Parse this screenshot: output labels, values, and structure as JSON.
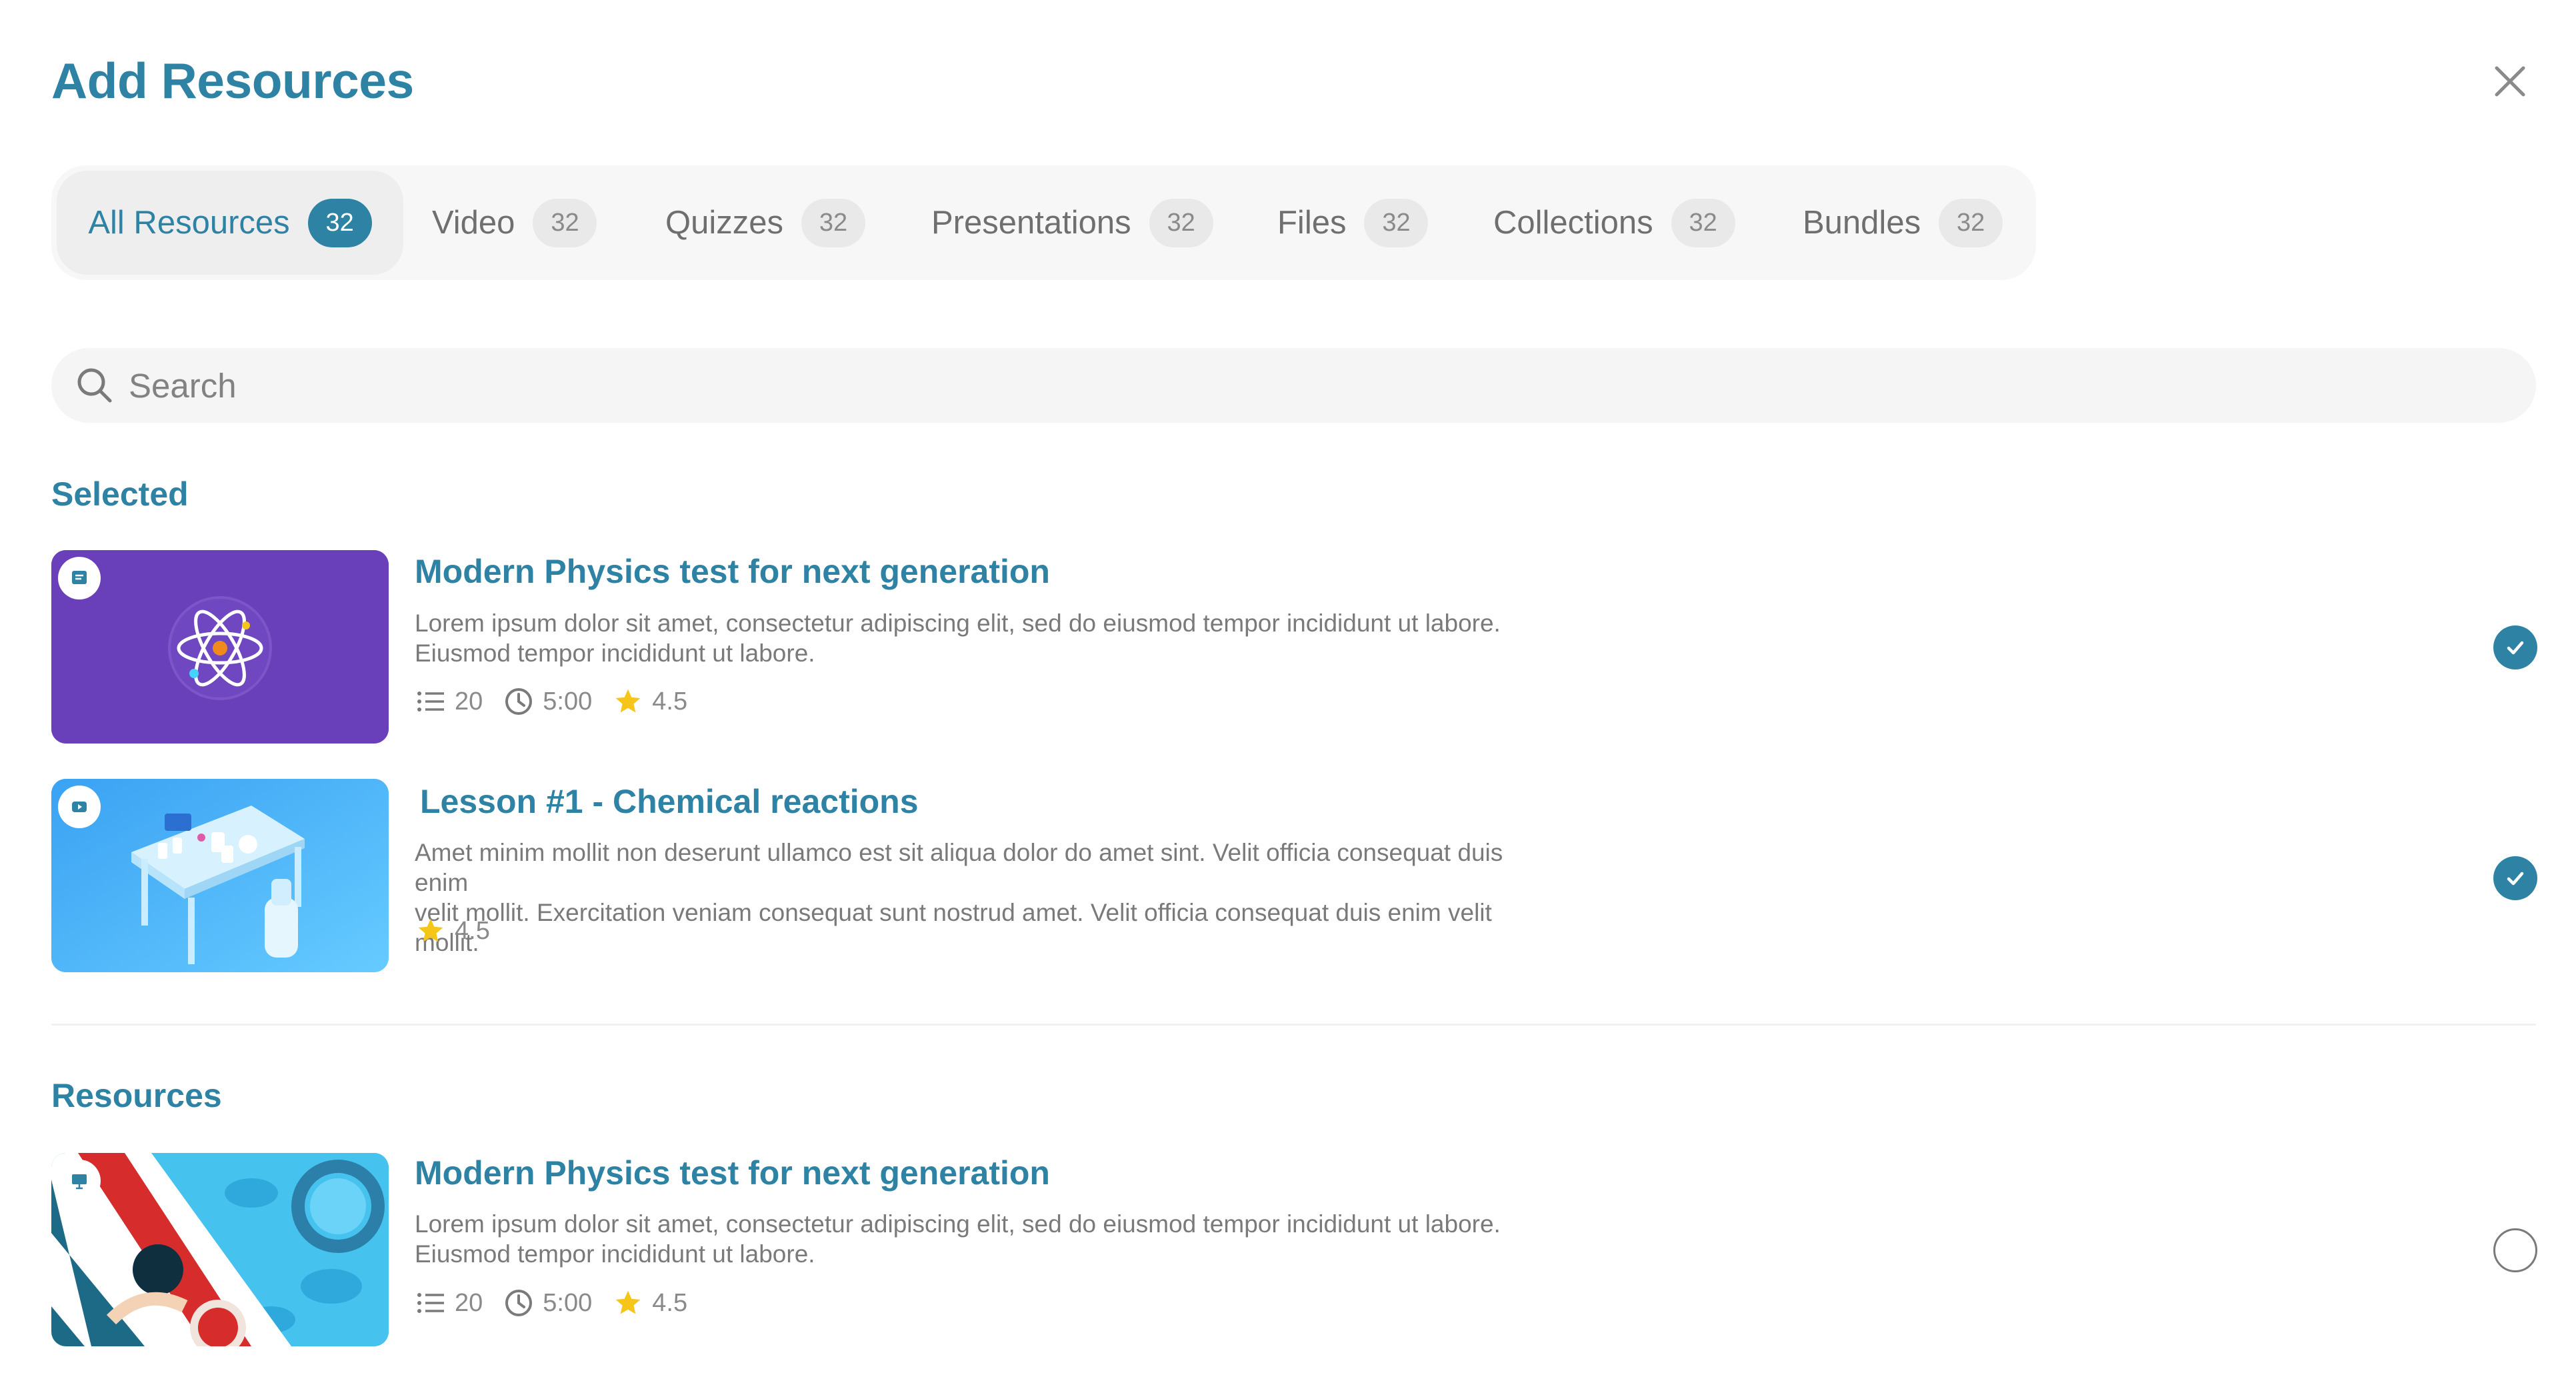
{
  "page": {
    "title": "Add Resources"
  },
  "tabs": [
    {
      "label": "All Resources",
      "count": "32",
      "active": true
    },
    {
      "label": "Video",
      "count": "32"
    },
    {
      "label": "Quizzes",
      "count": "32"
    },
    {
      "label": "Presentations",
      "count": "32"
    },
    {
      "label": "Files",
      "count": "32"
    },
    {
      "label": "Collections",
      "count": "32"
    },
    {
      "label": "Bundles",
      "count": "32"
    }
  ],
  "search": {
    "placeholder": "Search"
  },
  "selected": {
    "heading": "Selected",
    "items": [
      {
        "title": "Modern Physics test for next generation",
        "desc_line1": "Lorem ipsum dolor sit amet, consectetur adipiscing elit, sed do eiusmod tempor incididunt ut labore.",
        "desc_line2": "Eiusmod tempor incididunt ut labore.",
        "questions": "20",
        "duration": "5:00",
        "rating": "4.5",
        "type_icon": "quiz-icon",
        "selected": true
      },
      {
        "title": "Lesson #1 - Chemical reactions",
        "desc_line1": "Amet minim mollit non deserunt ullamco est sit aliqua dolor do amet sint. Velit officia consequat duis enim",
        "desc_line2": "velit mollit. Exercitation veniam consequat sunt nostrud amet. Velit officia consequat duis enim velit mollit.",
        "rating": "4.5",
        "type_icon": "video-icon",
        "selected": true
      }
    ]
  },
  "resources": {
    "heading": "Resources",
    "items": [
      {
        "title": "Modern Physics test for next generation",
        "desc_line1": "Lorem ipsum dolor sit amet, consectetur adipiscing elit, sed do eiusmod tempor incididunt ut labore.",
        "desc_line2": "Eiusmod tempor incididunt ut labore.",
        "questions": "20",
        "duration": "5:00",
        "rating": "4.5",
        "type_icon": "presentation-icon",
        "selected": false
      }
    ]
  },
  "colors": {
    "accent": "#2e83a5",
    "star": "#f5c518",
    "purple_thumb": "#6a3fba",
    "blue_thumb": "#4fb4f7"
  }
}
